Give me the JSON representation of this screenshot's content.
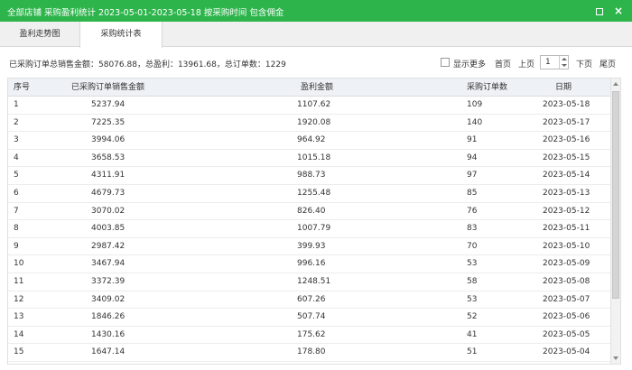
{
  "window": {
    "title": "全部店铺 采购盈利统计 2023-05-01-2023-05-18 按采购时间 包含佣金"
  },
  "tabs": [
    {
      "label": "盈利走势图",
      "active": false
    },
    {
      "label": "采购统计表",
      "active": true
    }
  ],
  "summary": "已采购订单总销售金额：58076.88，总盈利：13961.68，总订单数：1229",
  "pager": {
    "show_more_label": "显示更多",
    "show_more_checked": false,
    "first_label": "首页",
    "prev_label": "上页",
    "page_value": "1",
    "next_label": "下页",
    "last_label": "尾页"
  },
  "table": {
    "headers": {
      "idx": "序号",
      "amount": "已采购订单销售金额",
      "profit": "盈利金额",
      "orders": "采购订单数",
      "date": "日期"
    },
    "rows": [
      {
        "idx": "1",
        "amount": "5237.94",
        "profit": "1107.62",
        "orders": "109",
        "date": "2023-05-18"
      },
      {
        "idx": "2",
        "amount": "7225.35",
        "profit": "1920.08",
        "orders": "140",
        "date": "2023-05-17"
      },
      {
        "idx": "3",
        "amount": "3994.06",
        "profit": "964.92",
        "orders": "91",
        "date": "2023-05-16"
      },
      {
        "idx": "4",
        "amount": "3658.53",
        "profit": "1015.18",
        "orders": "94",
        "date": "2023-05-15"
      },
      {
        "idx": "5",
        "amount": "4311.91",
        "profit": "988.73",
        "orders": "97",
        "date": "2023-05-14"
      },
      {
        "idx": "6",
        "amount": "4679.73",
        "profit": "1255.48",
        "orders": "85",
        "date": "2023-05-13"
      },
      {
        "idx": "7",
        "amount": "3070.02",
        "profit": "826.40",
        "orders": "76",
        "date": "2023-05-12"
      },
      {
        "idx": "8",
        "amount": "4003.85",
        "profit": "1007.79",
        "orders": "83",
        "date": "2023-05-11"
      },
      {
        "idx": "9",
        "amount": "2987.42",
        "profit": "399.93",
        "orders": "70",
        "date": "2023-05-10"
      },
      {
        "idx": "10",
        "amount": "3467.94",
        "profit": "996.16",
        "orders": "53",
        "date": "2023-05-09"
      },
      {
        "idx": "11",
        "amount": "3372.39",
        "profit": "1248.51",
        "orders": "58",
        "date": "2023-05-08"
      },
      {
        "idx": "12",
        "amount": "3409.02",
        "profit": "607.26",
        "orders": "53",
        "date": "2023-05-07"
      },
      {
        "idx": "13",
        "amount": "1846.26",
        "profit": "507.74",
        "orders": "52",
        "date": "2023-05-06"
      },
      {
        "idx": "14",
        "amount": "1430.16",
        "profit": "175.62",
        "orders": "41",
        "date": "2023-05-05"
      },
      {
        "idx": "15",
        "amount": "1647.14",
        "profit": "178.80",
        "orders": "51",
        "date": "2023-05-04"
      }
    ]
  },
  "colors": {
    "titlebar": "#2db54c",
    "header_bg": "#eef1f5"
  }
}
